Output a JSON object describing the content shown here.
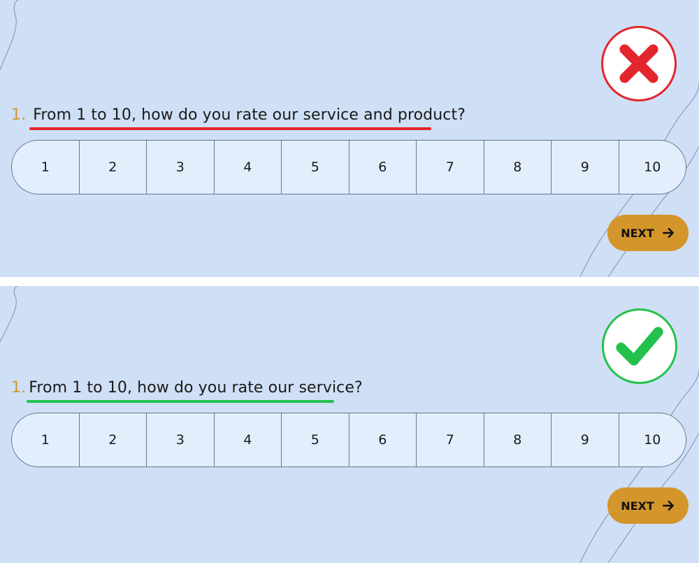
{
  "examples": [
    {
      "verdict_icon": "cross-icon",
      "accent_color": "#e3252d",
      "question_number": "1.",
      "question_text": "From 1 to 10, how do you rate our service and product?",
      "scale": [
        "1",
        "2",
        "3",
        "4",
        "5",
        "6",
        "7",
        "8",
        "9",
        "10"
      ],
      "next_label": "NEXT",
      "next_icon": "arrow-right-icon"
    },
    {
      "verdict_icon": "checkmark-icon",
      "accent_color": "#23c24d",
      "question_number": "1.",
      "question_text": "From 1 to 10, how do you rate our service?",
      "scale": [
        "1",
        "2",
        "3",
        "4",
        "5",
        "6",
        "7",
        "8",
        "9",
        "10"
      ],
      "next_label": "NEXT",
      "next_icon": "arrow-right-icon"
    }
  ],
  "colors": {
    "background": "#cfdff5",
    "button": "#d4952b",
    "number": "#d4952b",
    "scale_fill": "#e3eefc",
    "scale_border": "#5f7893"
  }
}
